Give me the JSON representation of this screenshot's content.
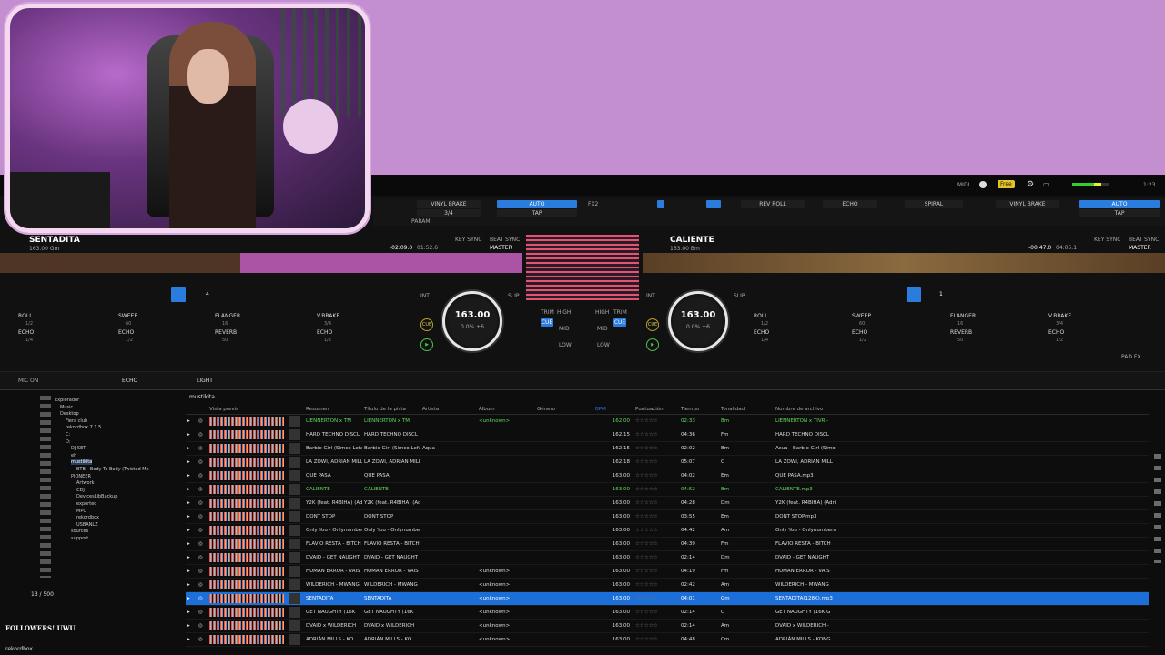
{
  "app": {
    "name": "rekordbox",
    "status": "Free",
    "clock": "1:23"
  },
  "topbar": {
    "midi": "MIDI",
    "free": "Free"
  },
  "fx": {
    "left": {
      "vinyl_brake": "VINYL BRAKE",
      "auto": "AUTO",
      "tap": "TAP",
      "param": "PARAM",
      "beat": "3/4",
      "fx2": "FX2"
    },
    "right": {
      "rev_roll": "REV ROLL",
      "echo": "ECHO",
      "spiral": "SPIRAL",
      "vinyl_brake": "VINYL BRAKE",
      "auto": "AUTO",
      "tap": "TAP"
    }
  },
  "deck1": {
    "title": "SENTADITA",
    "bpm_key": "163.00 Gm",
    "time": "-02:09.0",
    "remain": "01:52.6",
    "key_sync": "KEY SYNC",
    "beat_sync": "BEAT SYNC",
    "master": "MASTER",
    "jog_bpm": "163.00",
    "jog_pct": "0.0% ±6",
    "beat_count": "4",
    "int": "INT",
    "slip": "SLIP",
    "cue": "CUE",
    "fx_rows": [
      {
        "label": "ROLL",
        "val": "1/2"
      },
      {
        "label": "SWEEP",
        "val": "60"
      },
      {
        "label": "FLANGER",
        "val": "16"
      },
      {
        "label": "V.BRAKE",
        "val": "3/4"
      },
      {
        "label": "ECHO",
        "val": "1/4"
      },
      {
        "label": "ECHO",
        "val": "1/2"
      },
      {
        "label": "REVERB",
        "val": "50"
      },
      {
        "label": "ECHO",
        "val": "1/2"
      }
    ]
  },
  "deck2": {
    "title": "CALIENTE",
    "bpm_key": "163.00 Bm",
    "time": "-00:47.0",
    "remain": "04:05.1",
    "key_sync": "KEY SYNC",
    "beat_sync": "BEAT SYNC",
    "master": "MASTER",
    "jog_bpm": "163.00",
    "jog_pct": "0.0% ±6",
    "beat_count": "1",
    "int": "INT",
    "slip": "SLIP",
    "cue": "CUE",
    "fx_rows": [
      {
        "label": "ROLL",
        "val": "1/2"
      },
      {
        "label": "SWEEP",
        "val": "60"
      },
      {
        "label": "FLANGER",
        "val": "16"
      },
      {
        "label": "V.BRAKE",
        "val": "3/4"
      },
      {
        "label": "ECHO",
        "val": "1/4"
      },
      {
        "label": "ECHO",
        "val": "1/2"
      },
      {
        "label": "REVERB",
        "val": "50"
      },
      {
        "label": "ECHO",
        "val": "1/2"
      }
    ]
  },
  "mixer": {
    "trim": "TRIM",
    "high": "HIGH",
    "mid": "MID",
    "low": "LOW",
    "cue": "CUE"
  },
  "bottombar": {
    "mic": "MIC ON",
    "echo": "ECHO",
    "light": "LIGHT",
    "pad_fx": "PAD FX"
  },
  "browser": {
    "breadcrumb": "mustikita",
    "tree": [
      "Explorador",
      "Music",
      "Desktop",
      "Fiera club",
      "rekordbox 7.1.5",
      "C:",
      "D:",
      "DJ SET",
      "eh",
      "mustikita",
      "BTB - Body To Body (Twisted Me",
      "PIONEER",
      "Artwork",
      "CDJ",
      "DevicesLibBackup",
      "exported",
      "MPU",
      "rekordbox",
      "USBANLZ",
      "sources",
      "support"
    ],
    "columns": [
      "Vista previa",
      "",
      "Resumen",
      "Título de la pista",
      "Artista",
      "Álbum",
      "Género",
      "BPM",
      "Puntuación",
      "Tiempo",
      "Tonalidad",
      "Nombre de archivo"
    ],
    "rows": [
      {
        "summary": "LIENNERTON x TM",
        "title": "LIENNERTON x TM",
        "artist": "",
        "album": "<unknown>",
        "bpm": "162.00",
        "time": "02:33",
        "key": "Bm",
        "file": "LIENNERTON x TIVR -",
        "green": true
      },
      {
        "summary": "HARD TECHNO DISCL",
        "title": "HARD TECHNO DISCL",
        "artist": "",
        "album": "",
        "bpm": "162.15",
        "time": "04:36",
        "key": "Fm",
        "file": "HARD TECHNO DISCL",
        "green": false
      },
      {
        "summary": "Barbie Girl (Simco Lefa",
        "title": "Barbie Girl (Simco Lefa",
        "artist": "Aqua",
        "album": "",
        "bpm": "162.15",
        "time": "02:02",
        "key": "Bm",
        "file": "Acua - Barbie Girl (Simo",
        "green": false
      },
      {
        "summary": "LA ZOWI, ADRIÁN MILL",
        "title": "LA ZOWI, ADRIÁN MILL",
        "artist": "",
        "album": "",
        "bpm": "162.18",
        "time": "05:07",
        "key": "C",
        "file": "LA ZOWI, ADRIÁN MILL",
        "green": false
      },
      {
        "summary": "QUE PASA",
        "title": "QUE PASA",
        "artist": "",
        "album": "",
        "bpm": "163.00",
        "time": "04:02",
        "key": "Em",
        "file": "QUE PASA.mp3",
        "green": false
      },
      {
        "summary": "CALIENTE",
        "title": "CALIENTE",
        "artist": "",
        "album": "",
        "bpm": "163.00",
        "time": "04:52",
        "key": "Bm",
        "file": "CALIENTE.mp3",
        "green": true
      },
      {
        "summary": "Y2K (feat. R4BIHA) (Adi",
        "title": "Y2K (feat. R4BIHA) (Adri",
        "artist": "",
        "album": "",
        "bpm": "163.00",
        "time": "04:28",
        "key": "Dm",
        "file": "Y2K (feat. R4BIHA) (Adri",
        "green": false
      },
      {
        "summary": "DONT STOP",
        "title": "DONT STOP",
        "artist": "",
        "album": "",
        "bpm": "163.00",
        "time": "03:55",
        "key": "Em",
        "file": "DONT STOP.mp3",
        "green": false
      },
      {
        "summary": "Only You - Onlynumbers",
        "title": "Only You - Onlynumbers",
        "artist": "",
        "album": "",
        "bpm": "163.00",
        "time": "04:42",
        "key": "Am",
        "file": "Only You - Onlynumbers",
        "green": false
      },
      {
        "summary": "FLAVIO RESTA - BITCH",
        "title": "FLAVIO RESTA - BITCH",
        "artist": "",
        "album": "",
        "bpm": "163.00",
        "time": "04:39",
        "key": "Fm",
        "file": "FLAVIO RESTA - BITCH",
        "green": false
      },
      {
        "summary": "DVAID - GET NAUGHT",
        "title": "DVAID - GET NAUGHT",
        "artist": "",
        "album": "",
        "bpm": "163.00",
        "time": "02:14",
        "key": "Dm",
        "file": "DVAID - GET NAUGHT",
        "green": false
      },
      {
        "summary": "HUMAN ERROR - VAIS",
        "title": "HUMAN ERROR - VAIS",
        "artist": "",
        "album": "<unknown>",
        "bpm": "163.00",
        "time": "04:19",
        "key": "Fm",
        "file": "HUMAN ERROR - VAIS",
        "green": false
      },
      {
        "summary": "WILDERICH - MWANG",
        "title": "WILDERICH - MWANG",
        "artist": "",
        "album": "<unknown>",
        "bpm": "163.00",
        "time": "02:42",
        "key": "Am",
        "file": "WILDERICH - MWANG",
        "green": false
      },
      {
        "summary": "SENTADITA",
        "title": "SENTADITA",
        "artist": "",
        "album": "<unknown>",
        "bpm": "163.00",
        "time": "04:01",
        "key": "Gm",
        "file": "SENTADITA(128K).mp3",
        "green": false,
        "selected": true
      },
      {
        "summary": "GET NAUGHTY (16K",
        "title": "GET NAUGHTY (16K",
        "artist": "",
        "album": "<unknown>",
        "bpm": "163.00",
        "time": "02:14",
        "key": "C",
        "file": "GET NAUGHTY (16K G",
        "green": false
      },
      {
        "summary": "DVAID x WILDERICH",
        "title": "DVAID x WILDERICH",
        "artist": "",
        "album": "<unknown>",
        "bpm": "163.00",
        "time": "02:14",
        "key": "Am",
        "file": "DVAID x WILDERICH -",
        "green": false
      },
      {
        "summary": "ADRIÁN MILLS - KO",
        "title": "ADRIÁN MILLS - KO",
        "artist": "",
        "album": "<unknown>",
        "bpm": "163.00",
        "time": "04:48",
        "key": "Cm",
        "file": "ADRIÁN MILLS - KONG",
        "green": false
      }
    ]
  },
  "overlay": {
    "followers_count": "13 / 500",
    "followers_label": "FOLLOWERS! UWU"
  },
  "colors": {
    "accent": "#2a7cde",
    "background": "#c48fd0",
    "loaded_green": "#5fdc5f"
  }
}
